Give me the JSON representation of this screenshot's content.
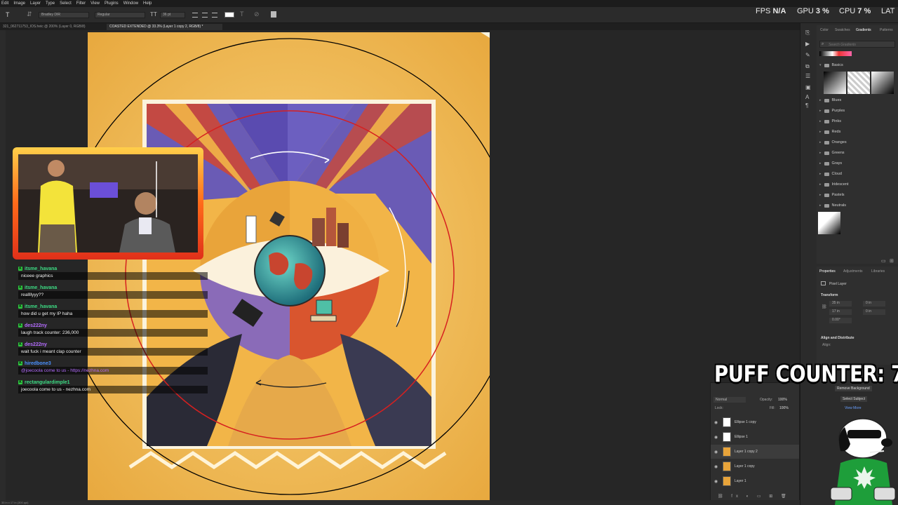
{
  "menu": [
    "Edit",
    "Image",
    "Layer",
    "Type",
    "Select",
    "Filter",
    "View",
    "Plugins",
    "Window",
    "Help"
  ],
  "options": {
    "font_family": "Bradley DIR",
    "font_style": "Regular",
    "font_size": "36 pt"
  },
  "tabs": [
    {
      "label": "321_062711753_IOS.heic @ 200% (Layer 0, RGB/8)",
      "active": false
    },
    {
      "label": "COASTED EXTENDED @ 33.3% (Layer 1 copy 2, RGB/8) *",
      "active": true
    }
  ],
  "stats": {
    "fps_label": "FPS",
    "fps_value": "N/A",
    "gpu_label": "GPU",
    "gpu_value": "3 %",
    "cpu_label": "CPU",
    "cpu_value": "7 %",
    "lat_label": "LAT"
  },
  "chat": [
    {
      "user": "itsme_havana",
      "color": "#3ddc84",
      "text": "niceee graphics"
    },
    {
      "user": "itsme_havana",
      "color": "#3ddc84",
      "text": "reallllyyy??"
    },
    {
      "user": "itsme_havana",
      "color": "#3ddc84",
      "text": "how did u get my IP haha"
    },
    {
      "user": "des222ny",
      "color": "#b46cff",
      "text": "laugh track counter: 236,000"
    },
    {
      "user": "des222ny",
      "color": "#b46cff",
      "text": "wait fuck i meant clap counter"
    },
    {
      "user": "hiredbone3",
      "color": "#4a90ff",
      "text_prefix": "@joecoola come to us - ",
      "text_link": "https://nezhna.com",
      "text": ""
    },
    {
      "user": "rectangulardimple1",
      "color": "#3ddc84",
      "text": "joecoola come to us - nezhna.com"
    }
  ],
  "gradients": {
    "tabs": [
      "Color",
      "Swatches",
      "Gradients",
      "Patterns"
    ],
    "search_placeholder": "Search Gradients",
    "basics_label": "Basics",
    "folders": [
      "Blues",
      "Purples",
      "Pinks",
      "Reds",
      "Oranges",
      "Greens",
      "Grays",
      "Cloud",
      "Iridescent",
      "Pastels",
      "Neutrals"
    ]
  },
  "properties": {
    "tabs": [
      "Properties",
      "Adjustments",
      "Libraries"
    ],
    "kind": "Pixel Layer",
    "transform_label": "Transform",
    "w": "35 in",
    "h": "17 in",
    "x": "0 in",
    "y": "0 in",
    "angle": "0.00°",
    "align_label": "Align and Distribute",
    "align_sub": "Align:"
  },
  "layers": {
    "blend_mode": "Normal",
    "opacity_label": "Opacity:",
    "opacity": "100%",
    "fill_label": "Fill:",
    "fill": "100%",
    "lock_label": "Lock:",
    "remove_bg": "Remove Background",
    "select_subject": "Select Subject",
    "view_more": "View More",
    "items": [
      {
        "name": "Ellipse 1 copy",
        "selected": false
      },
      {
        "name": "Ellipse 1",
        "selected": false
      },
      {
        "name": "Layer 1 copy 2",
        "selected": true
      },
      {
        "name": "Layer 1 copy",
        "selected": false
      },
      {
        "name": "Layer 1",
        "selected": false
      }
    ]
  },
  "overlay": {
    "puff_counter": "PUFF COUNTER: 7"
  },
  "statusbar": "35 in x 17 in (300 ppi)",
  "colors": {
    "canvas_bg": "#f3c25b",
    "art_purple": "#6a5bb5",
    "art_red": "#c83a2a",
    "circle_red": "#d62020"
  }
}
